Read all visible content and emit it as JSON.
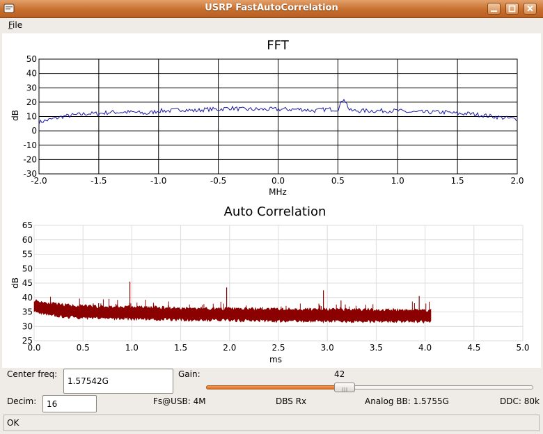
{
  "window": {
    "title": "USRP FastAutoCorrelation"
  },
  "menu": {
    "file_accel": "F",
    "file_rest": "ile"
  },
  "fft": {
    "title": "FFT",
    "xlabel": "MHz",
    "ylabel": "dB",
    "xticks": [
      "-2.0",
      "-1.5",
      "-1.0",
      "-0.5",
      "0.0",
      "0.5",
      "1.0",
      "1.5",
      "2.0"
    ],
    "yticks": [
      "50",
      "40",
      "30",
      "20",
      "10",
      "0",
      "-10",
      "-20",
      "-30"
    ]
  },
  "autocorr": {
    "title": "Auto Correlation",
    "xlabel": "ms",
    "ylabel": "dB",
    "xticks": [
      "0.0",
      "0.5",
      "1.0",
      "1.5",
      "2.0",
      "2.5",
      "3.0",
      "3.5",
      "4.0",
      "4.5",
      "5.0"
    ],
    "yticks": [
      "65",
      "60",
      "55",
      "50",
      "45",
      "40",
      "35",
      "30",
      "25"
    ]
  },
  "chart_data": [
    {
      "type": "line",
      "title": "FFT",
      "xlabel": "MHz",
      "ylabel": "dB",
      "xlim": [
        -2.0,
        2.0
      ],
      "ylim": [
        -30,
        50
      ],
      "grid": true,
      "color": "#1a1aa8",
      "x": [
        -2.0,
        -1.9,
        -1.8,
        -1.7,
        -1.6,
        -1.5,
        -1.4,
        -1.3,
        -1.2,
        -1.1,
        -1.0,
        -0.9,
        -0.8,
        -0.7,
        -0.6,
        -0.5,
        -0.4,
        -0.3,
        -0.2,
        -0.1,
        0.0,
        0.1,
        0.2,
        0.3,
        0.4,
        0.5,
        0.55,
        0.6,
        0.7,
        0.8,
        0.9,
        1.0,
        1.1,
        1.2,
        1.3,
        1.4,
        1.5,
        1.6,
        1.7,
        1.8,
        1.9,
        2.0
      ],
      "y": [
        6,
        8,
        10,
        11,
        12,
        12,
        13,
        13,
        13,
        12,
        14,
        14,
        15,
        14,
        15,
        15,
        16,
        15,
        15,
        15,
        15,
        15,
        15,
        14,
        15,
        15,
        23,
        14,
        14,
        14,
        14,
        14,
        13,
        13,
        13,
        13,
        12,
        12,
        11,
        10,
        9,
        8
      ]
    },
    {
      "type": "line",
      "title": "Auto Correlation",
      "xlabel": "ms",
      "ylabel": "dB",
      "xlim": [
        0.0,
        5.0
      ],
      "ylim": [
        25,
        65
      ],
      "grid": true,
      "color": "#8b0000",
      "x": [
        0.0,
        0.25,
        0.5,
        0.75,
        1.0,
        1.25,
        1.5,
        1.75,
        2.0,
        2.25,
        2.5,
        2.75,
        3.0,
        3.25,
        3.5,
        3.75,
        4.0,
        4.06
      ],
      "y": [
        37,
        35.5,
        35,
        34.8,
        34.7,
        34.5,
        34.3,
        34.2,
        34.1,
        34.0,
        33.9,
        33.9,
        33.8,
        33.8,
        33.7,
        33.7,
        33.6,
        33.6
      ],
      "band_halfwidth_db": 2,
      "peaks": [
        {
          "x": 0.98,
          "y": 45.5
        },
        {
          "x": 1.97,
          "y": 43.5
        },
        {
          "x": 2.96,
          "y": 42.5
        },
        {
          "x": 3.14,
          "y": 39
        },
        {
          "x": 3.94,
          "y": 40.5
        },
        {
          "x": 0.66,
          "y": 38
        }
      ]
    }
  ],
  "controls": {
    "center_freq_label": "Center freq:",
    "center_freq_value": "1.57542G",
    "gain_label": "Gain:",
    "gain_value": "42",
    "gain_fraction": 0.42,
    "decim_label": "Decim:",
    "decim_value": "16",
    "fs_usb": "Fs@USB: 4M",
    "dbs_rx": "DBS Rx",
    "analog_bb": "Analog BB: 1.5755G",
    "ddc": "DDC: 80k"
  },
  "status": {
    "text": "OK"
  }
}
